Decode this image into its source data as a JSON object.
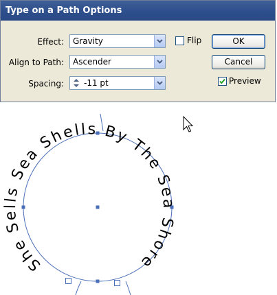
{
  "dialog": {
    "title": "Type on a Path Options",
    "effect_label": "Effect:",
    "effect_value": "Gravity",
    "align_label": "Align to Path:",
    "align_value": "Ascender",
    "spacing_label": "Spacing:",
    "spacing_value": "-11 pt",
    "flip_label": "Flip",
    "flip_checked": false,
    "ok_label": "OK",
    "cancel_label": "Cancel",
    "preview_label": "Preview",
    "preview_checked": true
  },
  "artwork": {
    "path_text": "She Sells Sea Shells By The Sea Shore",
    "text_color": "#000000",
    "path_color": "#4a6fb8"
  }
}
